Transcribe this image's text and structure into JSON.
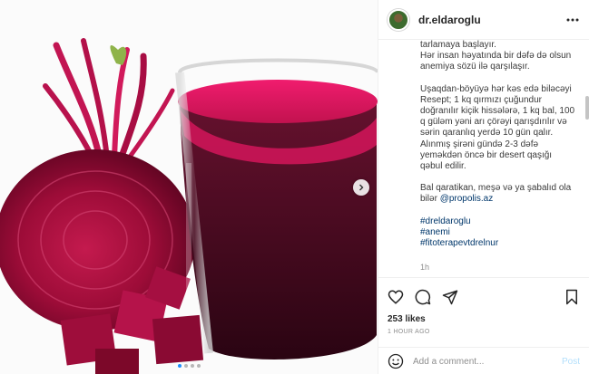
{
  "header": {
    "username": "dr.eldaroglu"
  },
  "caption": {
    "lines_1": [
      "tarlamaya başlayır.",
      "Hər insan həyatında bir dəfə də olsun anemiya sözü ilə qarşılaşır."
    ],
    "p1": "tarlamaya başlayır.",
    "p2": "Hər insan həyatında bir dəfə də olsun anemiya sözü ilə qarşılaşır.",
    "p3": "Uşaqdan-böyüyə hər kəs edə biləcəyi Resept; 1 kq qırmızı çuğundur doğranılır kiçik hissələrə, 1 kq bal, 100 q güləm yəni arı çörəyi qarışdırılır və sərin qaranlıq yerdə 10 gün qalır. Alınmış şirəni gündə 2-3 dəfə yeməkdən öncə bir desert qaşığı qəbul edilir.",
    "p4_text": "Bal qaratikan, meşə və ya şabalıd ola bilər ",
    "p4_mention": "@propolis.az",
    "hashtags": [
      "#dreldaroglu",
      "#anemi",
      "#fitoterapevtdrelnur"
    ],
    "time": "1h"
  },
  "actions": {
    "likes": "253 likes",
    "posted": "1 HOUR AGO",
    "comment_placeholder": "Add a comment...",
    "post_label": "Post"
  },
  "carousel": {
    "dots": 4,
    "active": 0
  },
  "colors": {
    "accent": "#0095f6",
    "link": "#00376b",
    "beet": "#8c0b30",
    "juice": "#4a0f22"
  }
}
